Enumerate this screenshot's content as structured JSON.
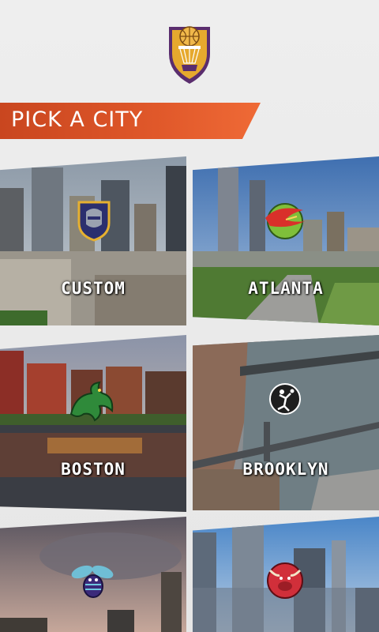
{
  "header": {
    "logo_icon": "basketball-shield-icon",
    "title": "PICK A CITY"
  },
  "cities": [
    {
      "label": "CUSTOM",
      "emblem": "knight-helmet-icon"
    },
    {
      "label": "ATLANTA",
      "emblem": "hawk-icon"
    },
    {
      "label": "BOSTON",
      "emblem": "dragon-icon"
    },
    {
      "label": "BROOKLYN",
      "emblem": "player-silhouette-icon"
    },
    {
      "label": "",
      "emblem": "hornet-icon"
    },
    {
      "label": "",
      "emblem": "bull-icon"
    }
  ],
  "colors": {
    "accent": "#e0582a",
    "logo_gold": "#e6a92e",
    "logo_purple": "#5a2d6e"
  }
}
